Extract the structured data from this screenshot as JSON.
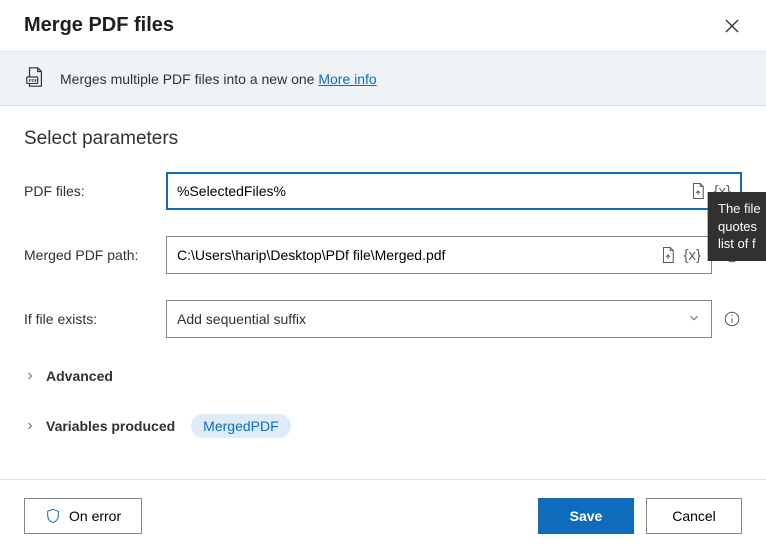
{
  "header": {
    "title": "Merge PDF files"
  },
  "banner": {
    "description_prefix": "Merges multiple PDF files into a new one ",
    "more_info": "More info"
  },
  "section": {
    "title": "Select parameters"
  },
  "fields": {
    "pdf_files": {
      "label": "PDF files:",
      "value": "%SelectedFiles%"
    },
    "merged_path": {
      "label": "Merged PDF path:",
      "value": "C:\\Users\\harip\\Desktop\\PDf file\\Merged.pdf"
    },
    "if_exists": {
      "label": "If file exists:",
      "value": "Add sequential suffix"
    }
  },
  "expanders": {
    "advanced": "Advanced",
    "variables_produced": "Variables produced",
    "variable_pill": "MergedPDF"
  },
  "footer": {
    "on_error": "On error",
    "save": "Save",
    "cancel": "Cancel"
  },
  "tooltip": {
    "text": "The file\nquotes\nlist of f"
  },
  "glyphs": {
    "var_token": "{x}"
  }
}
